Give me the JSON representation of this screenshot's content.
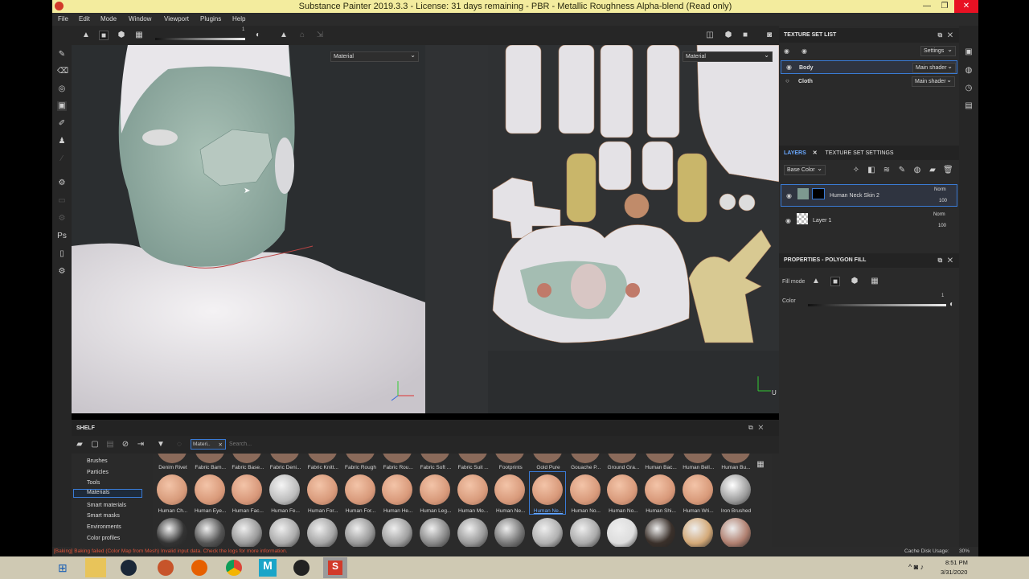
{
  "window": {
    "title": "Substance Painter 2019.3.3 - License: 31 days remaining - PBR - Metallic Roughness Alpha-blend (Read only)"
  },
  "menu": [
    "File",
    "Edit",
    "Mode",
    "Window",
    "Viewport",
    "Plugins",
    "Help"
  ],
  "toolbar": {
    "slider_value": "1"
  },
  "viewport3d": {
    "mode_dropdown": "Material"
  },
  "viewport2d": {
    "mode_dropdown": "Material",
    "axis_label": "U"
  },
  "texture_set_list": {
    "title": "TEXTURE SET LIST",
    "settings_label": "Settings",
    "sets": [
      {
        "name": "Body",
        "shader": "Main shader"
      },
      {
        "name": "Cloth",
        "shader": "Main shader"
      }
    ]
  },
  "layers": {
    "tab_layers": "LAYERS",
    "tab_texture_set_settings": "TEXTURE SET SETTINGS",
    "channel_dropdown": "Base Color",
    "items": [
      {
        "name": "Human Neck Skin 2",
        "blend": "Norm",
        "opacity": "100"
      },
      {
        "name": "Layer 1",
        "blend": "Norm",
        "opacity": "100"
      }
    ]
  },
  "properties": {
    "title": "PROPERTIES - POLYGON FILL",
    "fill_mode_label": "Fill mode",
    "color_label": "Color",
    "color_value": "1"
  },
  "shelf": {
    "title": "SHELF",
    "filter_chip": "Materi..",
    "search_placeholder": "Search...",
    "categories": [
      "Brushes",
      "Particles",
      "Tools",
      "Materials",
      "Smart materials",
      "Smart masks",
      "Environments",
      "Color profiles"
    ],
    "selected_category": "Materials",
    "row0_labels": [
      "Denim Rivet",
      "Fabric Bam...",
      "Fabric Base...",
      "Fabric Deni...",
      "Fabric Knitt...",
      "Fabric Rough",
      "Fabric Rou...",
      "Fabric Soft ...",
      "Fabric Suit ...",
      "Footprints",
      "Gold Pure",
      "Gouache P...",
      "Ground Gra...",
      "Human Bac...",
      "Human Bell...",
      "Human Bu..."
    ],
    "row1_labels": [
      "Human Ch...",
      "Human Eye...",
      "Human Fac...",
      "Human Fe...",
      "Human For...",
      "Human For...",
      "Human He...",
      "Human Leg...",
      "Human Mo...",
      "Human Ne...",
      "Human Ne...",
      "Human No...",
      "Human No...",
      "Human Shi...",
      "Human Wri...",
      "Iron Brushed"
    ],
    "selected_item": "Human Ne..."
  },
  "status": {
    "message": "[Baking] Baking failed (Color Map from Mesh) Invalid input data. Check the logs for more information.",
    "cache_label": "Cache Disk Usage:",
    "cache_value": "30%"
  },
  "taskbar": {
    "time": "8:51 PM",
    "date": "3/31/2020"
  },
  "colors": {
    "accent": "#3a7bd5",
    "status_error": "#e0543a",
    "title_bar": "#f3ec9e"
  }
}
